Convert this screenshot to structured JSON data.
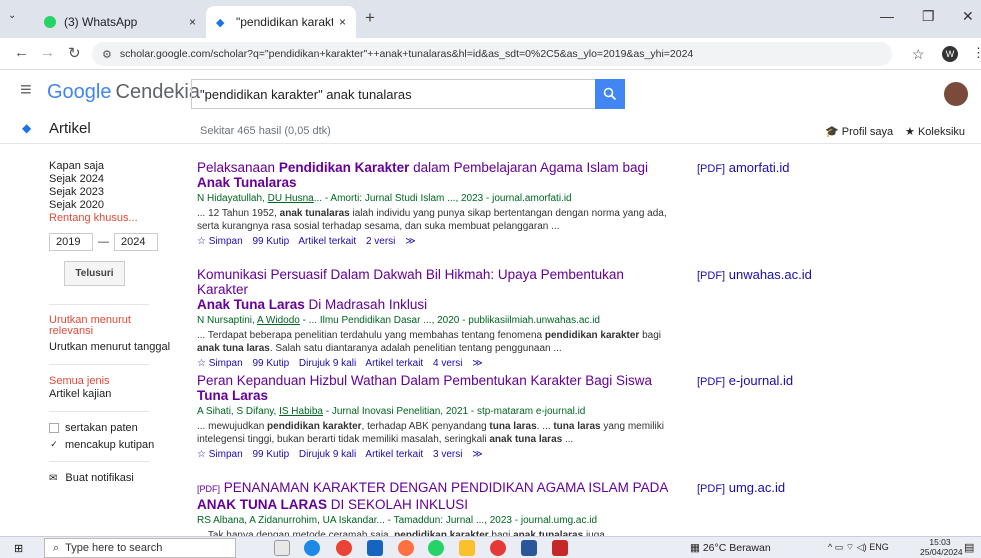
{
  "browser": {
    "tabs": [
      {
        "label": "(3) WhatsApp",
        "close": "×"
      },
      {
        "label": "\"pendidikan karakter\" anak tuna",
        "close": "×"
      }
    ],
    "new_tab": "+",
    "url": "scholar.google.com/scholar?q=\"pendidikan+karakter\"++anak+tunalaras&hl=id&as_sdt=0%2C5&as_ylo=2019&as_yhi=2024",
    "profile_initial": "W"
  },
  "header": {
    "logo_text": "Google",
    "logo_suffix": "Cendekia",
    "search_value": "\"pendidikan karakter\"  anak tunalaras"
  },
  "subbar": {
    "section": "Artikel",
    "result_count": "Sekitar 465 hasil (0,05 dtk)",
    "profile_link": "Profil saya",
    "library_link": "Koleksiku"
  },
  "sidebar": {
    "time_options": [
      "Kapan saja",
      "Sejak 2024",
      "Sejak 2023",
      "Sejak 2020"
    ],
    "custom_range": "Rentang khusus...",
    "year_from": "2019",
    "year_to": "2024",
    "search_button": "Telusuri",
    "sort_relevance": "Urutkan menurut relevansi",
    "sort_date": "Urutkan menurut tanggal",
    "all_types": "Semua jenis",
    "review_articles": "Artikel kajian",
    "include_patents": "sertakan paten",
    "include_citations": "mencakup kutipan",
    "create_alert": "Buat notifikasi"
  },
  "results": [
    {
      "title_a": "Pelaksanaan ",
      "title_b": "Pendidikan Karakter",
      "title_c": " dalam Pembelajaran Agama Islam bagi ",
      "title_d": "Anak Tunalaras",
      "authors_a": "N Hidayatullah, ",
      "authors_link": "DU Husna",
      "authors_b": "... - Amorti: Jurnal Studi Islam ..., 2023 - journal.amorfati.id",
      "snippet_a": "... 12 Tahun 1952, ",
      "snippet_b": "anak tunalaras",
      "snippet_c": " ialah individu yang punya sikap bertentangan dengan norma yang ada, serta kurangnya rasa sosial terhadap sesama, dan suka membuat pelanggaran ...",
      "links": [
        "☆ Simpan",
        "99 Kutip",
        "Artikel terkait",
        "2 versi",
        "≫"
      ],
      "pdf_tag": "[PDF]",
      "pdf_source": "amorfati.id"
    },
    {
      "title_a": "Komunikasi Persuasif Dalam Dakwah Bil Hikmah: Upaya Pembentukan Karakter ",
      "title_b": "Anak Tuna Laras",
      "title_c": " Di Madrasah Inklusi",
      "authors_a": "N Nursaptini, ",
      "authors_link": "A Widodo",
      "authors_b": "- ... Ilmu Pendidikan Dasar ..., 2020 - publikasiilmiah.unwahas.ac.id",
      "snippet_a": "... Terdapat beberapa penelitian terdahulu yang membahas tentang fenomena ",
      "snippet_b": "pendidikan karakter",
      "snippet_c": " bagi ",
      "snippet_d": "anak tuna laras",
      "snippet_e": ". Salah satu diantaranya adalah penelitian tentang penggunaan ...",
      "links": [
        "☆ Simpan",
        "99 Kutip",
        "Dirujuk 9 kali",
        "Artikel terkait",
        "4 versi",
        "≫"
      ],
      "pdf_tag": "[PDF]",
      "pdf_source": "unwahas.ac.id"
    },
    {
      "title_a": "Peran Kepanduan Hizbul Wathan Dalam Pembentukan Karakter Bagi Siswa ",
      "title_b": "Tuna Laras",
      "authors_a": "A Sihati, S Difany, ",
      "authors_link": "IS Habiba",
      "authors_b": "- Jurnal Inovasi Penelitian, 2021 - stp-mataram e-journal.id",
      "snippet_a": "... mewujudkan ",
      "snippet_b": "pendidikan karakter",
      "snippet_c": ", terhadap ABK penyandang ",
      "snippet_d": "tuna laras",
      "snippet_e": ". ... ",
      "snippet_f": "tuna laras",
      "snippet_g": " yang memiliki intelegensi tinggi, bukan berarti tidak memiliki masalah, seringkali ",
      "snippet_h": "anak tuna laras",
      "snippet_i": " ...",
      "links": [
        "☆ Simpan",
        "99 Kutip",
        "Dirujuk 9 kali",
        "Artikel terkait",
        "3 versi",
        "≫"
      ],
      "pdf_tag": "[PDF]",
      "pdf_source": "e-journal.id"
    },
    {
      "title_tag": "[PDF]",
      "title_a": " PENANAMAN KARAKTER DENGAN PENDIDIKAN AGAMA ISLAM PADA ",
      "title_b": "ANAK TUNA LARAS",
      "title_c": " DI SEKOLAH INKLUSI",
      "authors_a": "RS Albana, A Zidanurrohim, UA Iskandar... - Tamaddun: Jurnal ..., 2023 - journal.umg.ac.id",
      "snippet_a": "... Tak hanya dengan metode ceramah saja, ",
      "snippet_b": "pendidikan karakter",
      "snippet_c": " bagi ",
      "snippet_d": "anak tunalaras",
      "snippet_e": " juga",
      "pdf_tag": "[PDF]",
      "pdf_source": "umg.ac.id"
    }
  ],
  "taskbar": {
    "search_placeholder": "Type here to search",
    "weather": "26°C  Berawan",
    "lang": "ENG",
    "time": "15:03",
    "date": "25/04/2024"
  }
}
